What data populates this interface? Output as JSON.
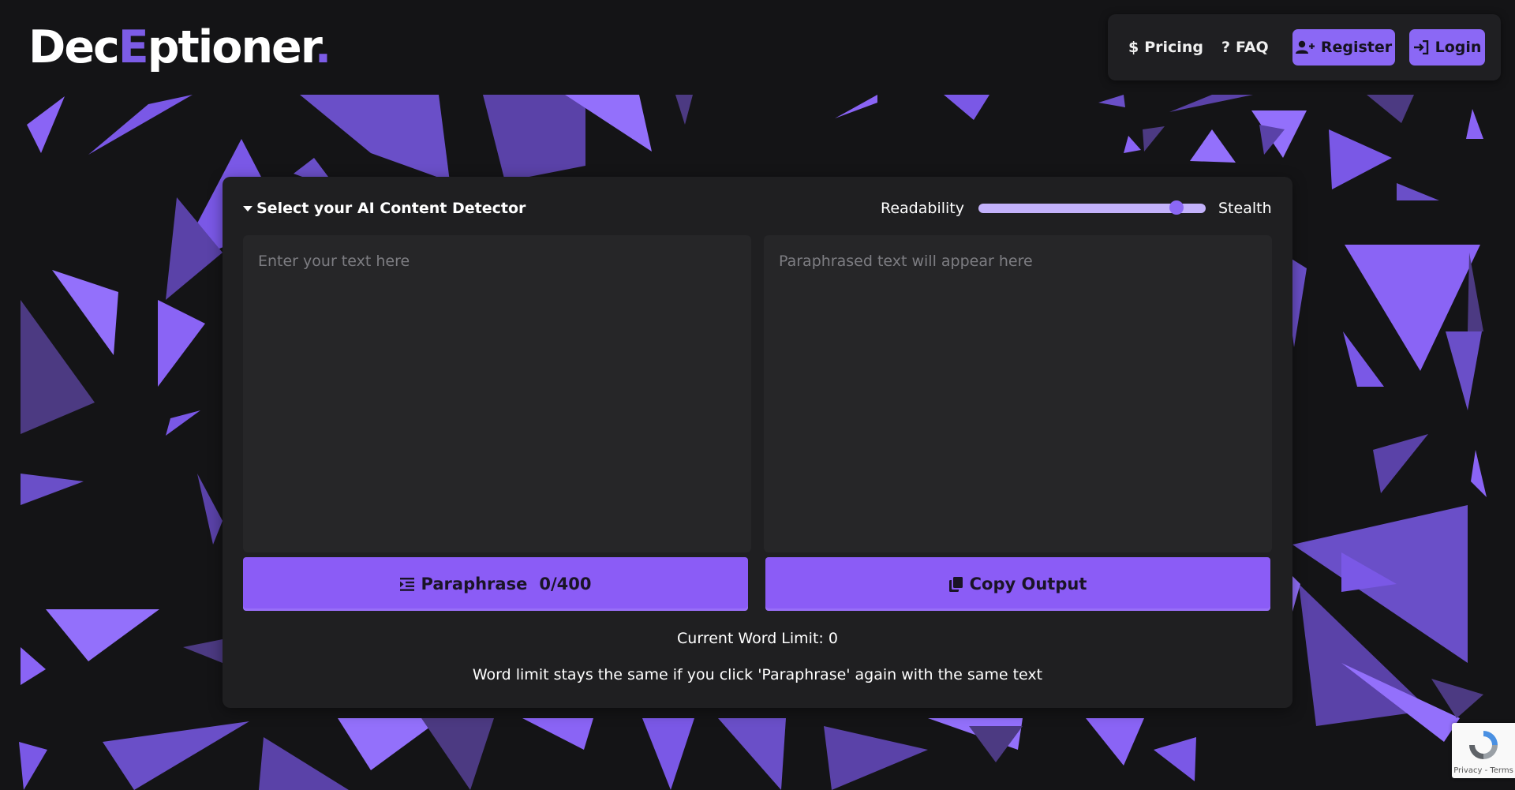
{
  "brand": {
    "prefix": "Dec",
    "accent": "E",
    "suffix": "ptioner",
    "dot": "."
  },
  "nav": {
    "pricing": "Pricing",
    "faq": "FAQ",
    "register": "Register",
    "login": "Login"
  },
  "editor": {
    "detector_label": "Select your AI Content Detector",
    "readability_label": "Readability",
    "stealth_label": "Stealth",
    "slider_level": 0.87,
    "input_placeholder": "Enter your text here",
    "input_value": "",
    "output_placeholder": "Paraphrased text will appear here",
    "output_value": "",
    "paraphrase_label": "Paraphrase",
    "word_count": "0/400",
    "copy_label": "Copy Output",
    "word_limit_text": "Current Word Limit: 0",
    "note_text": "Word limit stays the same if you click 'Paraphrase' again with the same text"
  },
  "recaptcha": {
    "text": "Privacy - Terms"
  },
  "colors": {
    "background": "#141416",
    "panel": "#1f1f21",
    "accent": "#8b5cf6",
    "slider_track": "#c3b2fb"
  },
  "icons": {
    "pricing": "dollar-icon",
    "faq": "question-icon",
    "register": "user-plus-icon",
    "login": "sign-in-icon",
    "detector": "caret-down-icon",
    "paraphrase": "indent-icon",
    "copy": "copy-icon",
    "recaptcha": "recaptcha-icon"
  }
}
